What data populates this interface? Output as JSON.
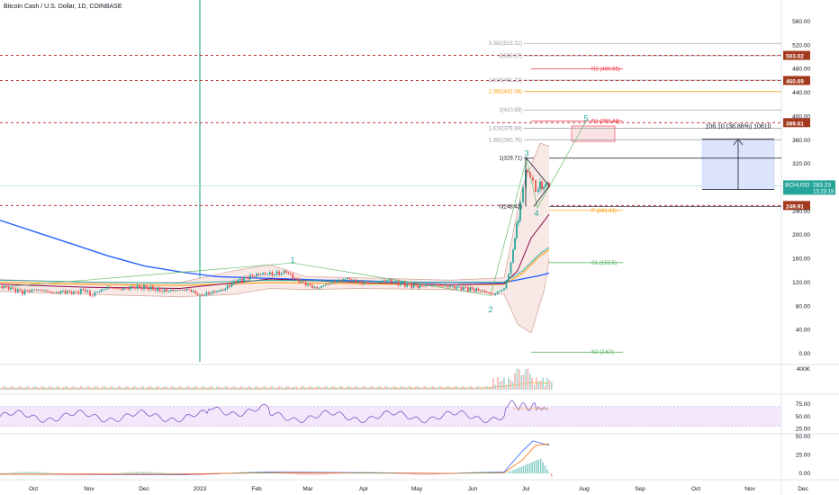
{
  "header": {
    "title": "Bitcoin Cash / U.S. Dollar, 1D, COINBASE"
  },
  "chart_data": {
    "type": "candlestick",
    "symbol": "BCHUSD",
    "price_axis": {
      "ylim": [
        -10,
        580
      ],
      "ticks": [
        0,
        40,
        80,
        120,
        160,
        200,
        240,
        280,
        320,
        360,
        400,
        440,
        480,
        520,
        560
      ],
      "tick_labels": [
        "0.00",
        "40.00",
        "80.00",
        "120.00",
        "160.00",
        "200.00",
        "240.00",
        "280.00",
        "320.00",
        "360.00",
        "400.00",
        "440.00",
        "480.00",
        "520.00",
        "560.00"
      ]
    },
    "time_axis": {
      "labels": [
        "Oct",
        "Nov",
        "Dec",
        "2023",
        "Feb",
        "Mar",
        "Apr",
        "May",
        "Jun",
        "Jul",
        "Aug",
        "Sep",
        "Oct",
        "Nov",
        "Dec"
      ]
    },
    "price_path": [
      [
        0,
        114
      ],
      [
        12,
        110
      ],
      [
        25,
        104
      ],
      [
        38,
        108
      ],
      [
        50,
        106
      ],
      [
        60,
        102
      ],
      [
        70,
        105
      ],
      [
        82,
        103
      ],
      [
        95,
        108
      ],
      [
        100,
        98
      ],
      [
        108,
        104
      ],
      [
        120,
        112
      ],
      [
        135,
        109
      ],
      [
        150,
        113
      ],
      [
        165,
        111
      ],
      [
        180,
        106
      ],
      [
        195,
        107
      ],
      [
        210,
        108
      ],
      [
        222,
        98
      ],
      [
        232,
        102
      ],
      [
        248,
        108
      ],
      [
        262,
        122
      ],
      [
        278,
        130
      ],
      [
        292,
        135
      ],
      [
        305,
        134
      ],
      [
        318,
        138
      ],
      [
        330,
        124
      ],
      [
        342,
        116
      ],
      [
        352,
        110
      ],
      [
        362,
        117
      ],
      [
        372,
        122
      ],
      [
        386,
        127
      ],
      [
        400,
        120
      ],
      [
        415,
        119
      ],
      [
        430,
        124
      ],
      [
        445,
        118
      ],
      [
        462,
        114
      ],
      [
        480,
        116
      ],
      [
        500,
        113
      ],
      [
        520,
        110
      ],
      [
        536,
        106
      ],
      [
        548,
        99
      ],
      [
        555,
        106
      ],
      [
        560,
        110
      ],
      [
        565,
        134
      ],
      [
        570,
        175
      ],
      [
        574,
        215
      ],
      [
        578,
        252
      ],
      [
        581,
        275
      ],
      [
        584,
        312
      ],
      [
        586,
        303
      ],
      [
        589,
        297
      ],
      [
        592,
        287
      ],
      [
        595,
        273
      ],
      [
        598,
        284
      ],
      [
        602,
        280
      ],
      [
        606,
        286
      ],
      [
        610,
        283
      ]
    ],
    "ma_long": [
      [
        0,
        225
      ],
      [
        40,
        205
      ],
      [
        80,
        185
      ],
      [
        120,
        165
      ],
      [
        160,
        148
      ],
      [
        200,
        138
      ],
      [
        240,
        130
      ],
      [
        280,
        128
      ],
      [
        320,
        126
      ],
      [
        360,
        124
      ],
      [
        400,
        123
      ],
      [
        440,
        121
      ],
      [
        480,
        120
      ],
      [
        520,
        120
      ],
      [
        560,
        120
      ],
      [
        600,
        132
      ],
      [
        610,
        136
      ]
    ],
    "ma_mid": [
      [
        0,
        120
      ],
      [
        100,
        117
      ],
      [
        200,
        115
      ],
      [
        300,
        120
      ],
      [
        400,
        118
      ],
      [
        500,
        116
      ],
      [
        560,
        117
      ],
      [
        580,
        135
      ],
      [
        600,
        165
      ],
      [
        610,
        175
      ]
    ],
    "ma_short": [
      [
        0,
        117
      ],
      [
        100,
        112
      ],
      [
        200,
        110
      ],
      [
        300,
        126
      ],
      [
        400,
        120
      ],
      [
        500,
        116
      ],
      [
        560,
        118
      ],
      [
        575,
        140
      ],
      [
        590,
        195
      ],
      [
        610,
        235
      ]
    ],
    "bb_upper": [
      [
        0,
        125
      ],
      [
        100,
        120
      ],
      [
        200,
        120
      ],
      [
        260,
        140
      ],
      [
        300,
        150
      ],
      [
        340,
        130
      ],
      [
        400,
        128
      ],
      [
        500,
        124
      ],
      [
        560,
        128
      ],
      [
        580,
        280
      ],
      [
        600,
        355
      ],
      [
        610,
        350
      ]
    ],
    "bb_lower": [
      [
        0,
        105
      ],
      [
        100,
        100
      ],
      [
        200,
        96
      ],
      [
        260,
        100
      ],
      [
        300,
        110
      ],
      [
        340,
        108
      ],
      [
        400,
        110
      ],
      [
        500,
        108
      ],
      [
        560,
        100
      ],
      [
        575,
        50
      ],
      [
        590,
        35
      ],
      [
        605,
        110
      ],
      [
        610,
        160
      ]
    ],
    "pivot_levels": [
      {
        "label": "R2 (480.55)",
        "value": 480.55,
        "color": "#f23645"
      },
      {
        "label": "R1 (392.44)",
        "value": 392.44,
        "color": "#f23645"
      },
      {
        "label": "P (241.61)",
        "value": 241.61,
        "color": "#ff9800"
      },
      {
        "label": "S1 (153.5)",
        "value": 153.5,
        "color": "#4caf50"
      },
      {
        "label": "S2 (2.67)",
        "value": 2.67,
        "color": "#4caf50"
      }
    ],
    "fib_levels": [
      {
        "label": "3.382(523.32)",
        "value": 523.32,
        "color": "#9598a1"
      },
      {
        "label": "3(502.57)",
        "value": 502.57,
        "color": "#9598a1"
      },
      {
        "label": "2.618(461.22)",
        "value": 461.22,
        "color": "#9598a1"
      },
      {
        "label": "2.382(442.04)",
        "value": 442.04,
        "color": "#ff9800"
      },
      {
        "label": "2(410.99)",
        "value": 410.99,
        "color": "#9598a1"
      },
      {
        "label": "1.618(379.94)",
        "value": 379.94,
        "color": "#9598a1"
      },
      {
        "label": "1.382(360.76)",
        "value": 360.76,
        "color": "#9598a1"
      },
      {
        "label": "1(329.71)",
        "value": 329.71,
        "color": "#131722"
      },
      {
        "label": "0(248.43)",
        "value": 248.43,
        "color": "#131722"
      }
    ],
    "dashed_levels": [
      {
        "value": 503.02,
        "label": "503.02"
      },
      {
        "value": 460.69,
        "label": "460.69"
      },
      {
        "value": 389.61,
        "label": "389.61"
      },
      {
        "value": 249.91,
        "label": "249.91"
      }
    ],
    "current_price": {
      "value": 283.23,
      "label": "283.23",
      "symbol": "BCHUSD",
      "countdown": "13:23:18"
    },
    "measure_label": "106.10 (38.86%) 10610",
    "wave_labels": [
      {
        "text": "1",
        "x": 325,
        "price": 153
      },
      {
        "text": "2",
        "x": 545,
        "price": 70
      },
      {
        "text": "3",
        "x": 585,
        "price": 333
      },
      {
        "text": "4",
        "x": 596,
        "price": 232
      },
      {
        "text": "5",
        "x": 651,
        "price": 392
      }
    ],
    "volume_axis_label": "400K",
    "rsi": {
      "ticks": [
        75,
        50,
        25
      ],
      "tick_labels": [
        "75.00",
        "50.00",
        "25.00"
      ]
    },
    "macd": {
      "ticks": [
        50,
        25,
        0
      ],
      "tick_labels": [
        "50.00",
        "25.00",
        "0.00"
      ]
    }
  }
}
